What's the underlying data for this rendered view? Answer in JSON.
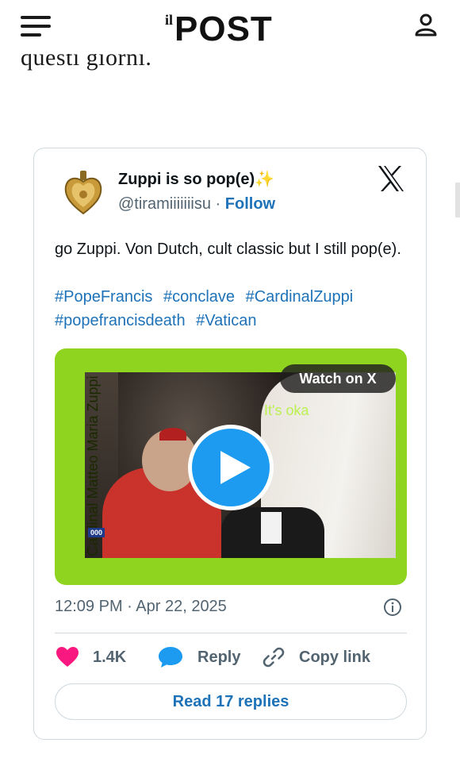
{
  "header": {
    "logo_il": "il",
    "logo_post": "POST"
  },
  "article": {
    "text": "questi giorni."
  },
  "tweet": {
    "author_name": "Zuppi is so pop(e)",
    "author_emoji": "✨",
    "handle": "@tiramiiiiiiisu",
    "separator": "·",
    "follow_label": "Follow",
    "text": "go Zuppi. Von Dutch, cult classic but I still pop(e).",
    "hashtags": [
      "#PopeFrancis",
      "#conclave",
      "#CardinalZuppi",
      "#popefrancisdeath",
      "#Vatican"
    ],
    "media": {
      "vertical_title": "Cardinal Matteo Maria Zuppi",
      "caption_overlay": "It's oka",
      "ticker": "000",
      "watch_label": "Watch on X"
    },
    "timestamp": "12:09 PM · Apr 22, 2025",
    "likes": "1.4K",
    "reply_label": "Reply",
    "copy_link_label": "Copy link",
    "read_replies_label": "Read 17 replies"
  },
  "icons": {
    "menu": "hamburger-menu-icon",
    "user": "user-icon",
    "x": "x-logo-icon",
    "play": "play-icon",
    "info": "info-icon",
    "heart": "heart-icon",
    "reply": "reply-bubble-icon",
    "link": "link-icon"
  },
  "colors": {
    "link_blue": "#1d72b8",
    "play_blue": "#1d9bf0",
    "heart_pink": "#f91880",
    "media_green": "#8fd41f",
    "muted_gray": "#536471"
  }
}
